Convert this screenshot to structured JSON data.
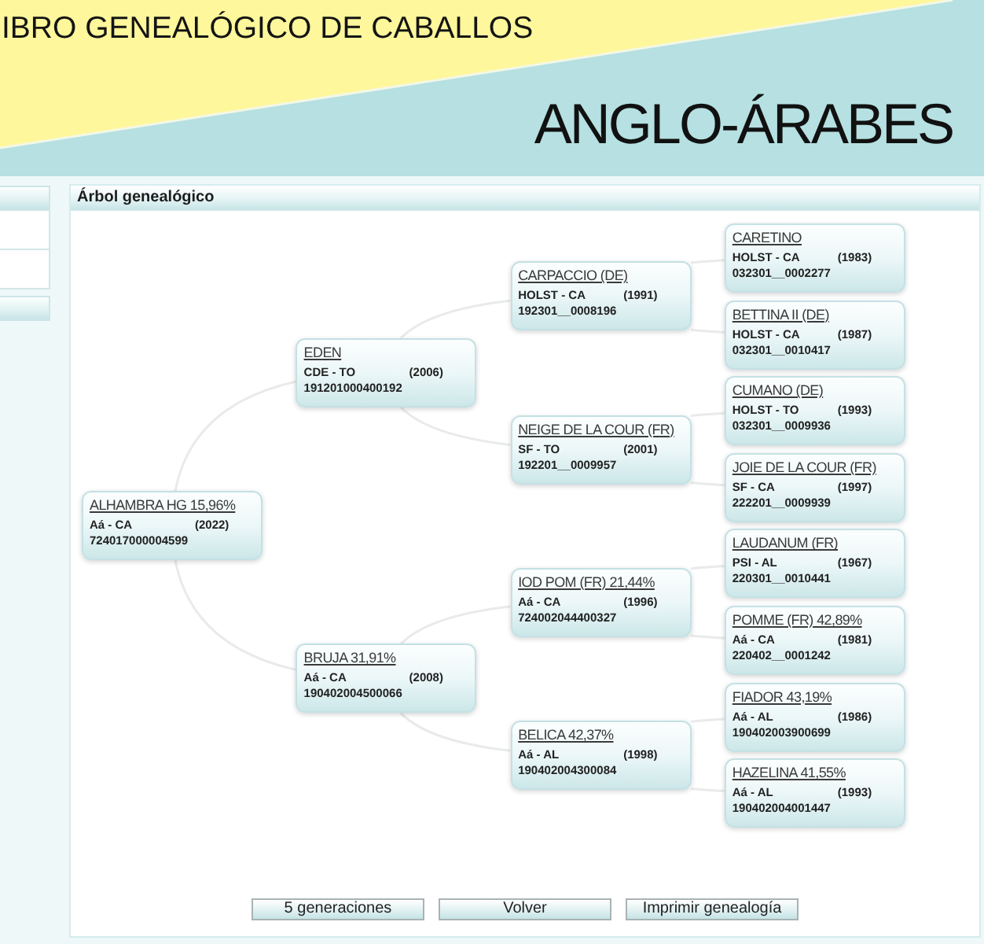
{
  "header": {
    "title": "IBRO GENEALÓGICO DE CABALLOS",
    "subtitle": "ANGLO-ÁRABES"
  },
  "panel": {
    "title": "Árbol genealógico"
  },
  "pedigree": {
    "name": "ALHAMBRA HG 15,96%",
    "breed": "Aá - CA",
    "year": "(2022)",
    "id": "724017000004599",
    "children": [
      {
        "name": "EDEN",
        "breed": "CDE - TO",
        "year": "(2006)",
        "id": "191201000400192",
        "children": [
          {
            "name": "CARPACCIO (DE)",
            "breed": "HOLST - CA",
            "year": "(1991)",
            "id": "192301__0008196",
            "children": [
              {
                "name": "CARETINO",
                "breed": "HOLST - CA",
                "year": "(1983)",
                "id": "032301__0002277"
              },
              {
                "name": "BETTINA II (DE)",
                "breed": "HOLST - CA",
                "year": "(1987)",
                "id": "032301__0010417"
              }
            ]
          },
          {
            "name": "NEIGE DE LA COUR (FR)",
            "breed": "SF - TO",
            "year": "(2001)",
            "id": "192201__0009957",
            "children": [
              {
                "name": "CUMANO (DE)",
                "breed": "HOLST - TO",
                "year": "(1993)",
                "id": "032301__0009936"
              },
              {
                "name": "JOIE DE LA COUR (FR)",
                "breed": "SF - CA",
                "year": "(1997)",
                "id": "222201__0009939"
              }
            ]
          }
        ]
      },
      {
        "name": "BRUJA 31,91%",
        "breed": "Aá - CA",
        "year": "(2008)",
        "id": "190402004500066",
        "children": [
          {
            "name": "IOD POM (FR) 21,44%",
            "breed": "Aá - CA",
            "year": "(1996)",
            "id": "724002044400327",
            "children": [
              {
                "name": "LAUDANUM (FR)",
                "breed": "PSI - AL",
                "year": "(1967)",
                "id": "220301__0010441"
              },
              {
                "name": "POMME (FR) 42,89%",
                "breed": "Aá - CA",
                "year": "(1981)",
                "id": "220402__0001242"
              }
            ]
          },
          {
            "name": "BELICA 42,37%",
            "breed": "Aá - AL",
            "year": "(1998)",
            "id": "190402004300084",
            "children": [
              {
                "name": "FIADOR 43,19%",
                "breed": "Aá - AL",
                "year": "(1986)",
                "id": "190402003900699"
              },
              {
                "name": "HAZELINA 41,55%",
                "breed": "Aá - AL",
                "year": "(1993)",
                "id": "190402004001447"
              }
            ]
          }
        ]
      }
    ]
  },
  "buttons": [
    "5 generaciones",
    "Volver",
    "Imprimir genealogía"
  ]
}
